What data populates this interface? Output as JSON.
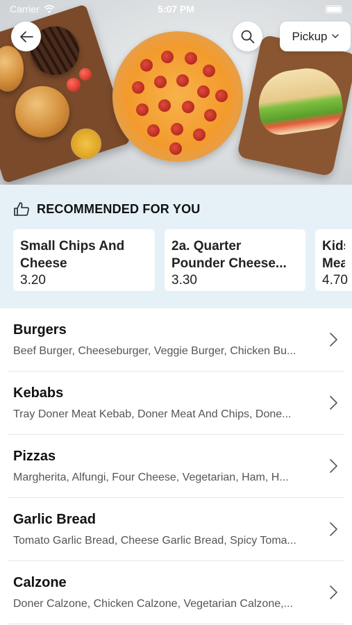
{
  "status_bar": {
    "carrier": "Carrier",
    "time": "5:07 PM"
  },
  "header": {
    "order_mode": "Pickup"
  },
  "icons": {
    "back": "arrow-left-icon",
    "search": "search-icon",
    "dropdown": "chevron-down-icon",
    "thumbs_up": "thumbs-up-icon",
    "chevron": "chevron-right-icon"
  },
  "recommended": {
    "title": "RECOMMENDED FOR YOU",
    "items": [
      {
        "name_line1": "Small Chips And",
        "name_line2": "Cheese",
        "price": "3.20"
      },
      {
        "name_line1": "2a. Quarter",
        "name_line2": "Pounder Cheese...",
        "price": "3.30"
      },
      {
        "name_line1": "Kids",
        "name_line2": "Mea",
        "price": "4.70"
      }
    ]
  },
  "categories": [
    {
      "name": "Burgers",
      "description": "Beef Burger, Cheeseburger, Veggie Burger, Chicken Bu..."
    },
    {
      "name": "Kebabs",
      "description": "Tray Doner Meat Kebab, Doner Meat And Chips, Done..."
    },
    {
      "name": "Pizzas",
      "description": "Margherita, Alfungi, Four Cheese, Vegetarian, Ham, H..."
    },
    {
      "name": "Garlic Bread",
      "description": "Tomato Garlic Bread, Cheese Garlic Bread, Spicy Toma..."
    },
    {
      "name": "Calzone",
      "description": "Doner Calzone, Chicken Calzone, Vegetarian Calzone,..."
    }
  ],
  "colors": {
    "recommended_bg": "#e5f1f7",
    "divider": "#e6e6e6",
    "text_primary": "#111111",
    "text_secondary": "#555555"
  }
}
